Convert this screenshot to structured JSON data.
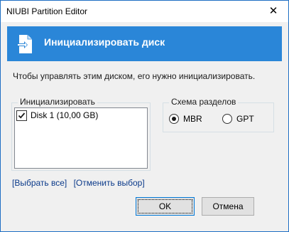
{
  "window": {
    "title": "NIUBI Partition Editor",
    "close_glyph": "✕"
  },
  "banner": {
    "title": "Инициализировать диск",
    "icon": "disk-import-icon",
    "color": "#2a86d8"
  },
  "instruction": "Чтобы управлять этим диском, его нужно инициализировать.",
  "initialize_group": {
    "legend": "Инициализировать",
    "disks": [
      {
        "label": "Disk 1 (10,00 GB)",
        "checked": true
      }
    ]
  },
  "scheme_group": {
    "legend": "Схема разделов",
    "options": [
      {
        "label": "MBR",
        "selected": true
      },
      {
        "label": "GPT",
        "selected": false
      }
    ]
  },
  "links": {
    "select_all": "[Выбрать все]",
    "deselect": "[Отменить выбор]"
  },
  "buttons": {
    "ok": "OK",
    "cancel": "Отмена"
  }
}
